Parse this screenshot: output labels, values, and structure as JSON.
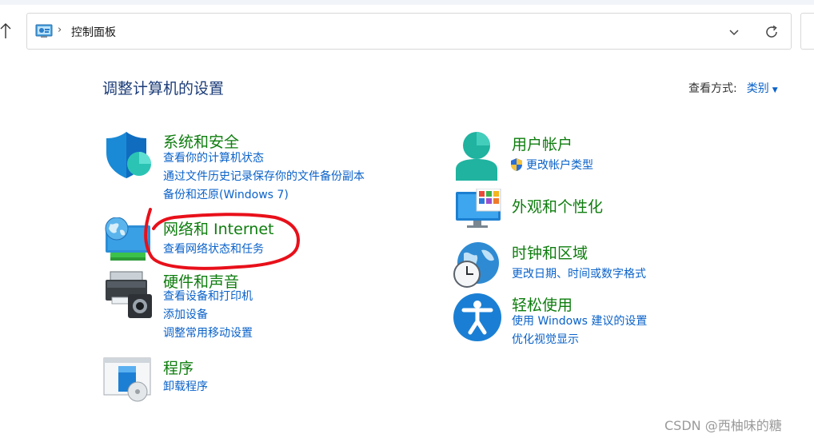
{
  "address_bar": {
    "location": "控制面板"
  },
  "page_title": "调整计算机的设置",
  "view_by": {
    "label": "查看方式:",
    "value": "类别"
  },
  "left_categories": [
    {
      "title": "系统和安全",
      "links": [
        "查看你的计算机状态",
        "通过文件历史记录保存你的文件备份副本",
        "备份和还原(Windows 7)"
      ]
    },
    {
      "title": "网络和 Internet",
      "links": [
        "查看网络状态和任务"
      ]
    },
    {
      "title": "硬件和声音",
      "links": [
        "查看设备和打印机",
        "添加设备",
        "调整常用移动设置"
      ]
    },
    {
      "title": "程序",
      "links": [
        "卸载程序"
      ]
    }
  ],
  "right_categories": [
    {
      "title": "用户帐户",
      "links": [
        "更改帐户类型"
      ]
    },
    {
      "title": "外观和个性化",
      "links": []
    },
    {
      "title": "时钟和区域",
      "links": [
        "更改日期、时间或数字格式"
      ]
    },
    {
      "title": "轻松使用",
      "links": [
        "使用 Windows 建议的设置",
        "优化视觉显示"
      ]
    }
  ],
  "watermark": "CSDN @西柚味的糖",
  "colors": {
    "category_title": "#0e7d0e",
    "link": "#0a62c9",
    "page_title": "#1c3c78",
    "annotation": "#e8101a"
  }
}
